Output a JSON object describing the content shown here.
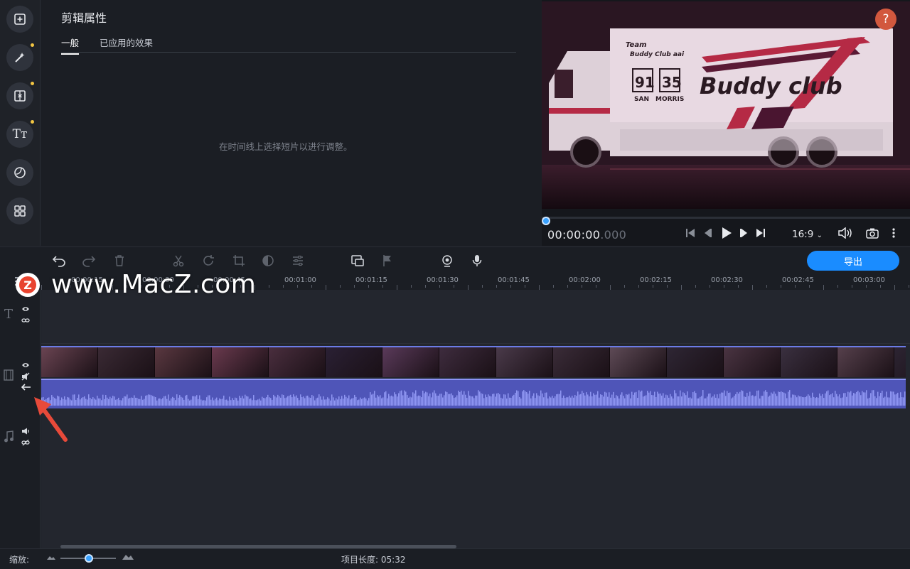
{
  "colors": {
    "accent": "#1a8cff",
    "help": "#d2583e",
    "audio": "#4f55b8",
    "dot": "#f2c542"
  },
  "left_bar": {
    "items": [
      {
        "icon": "import-icon",
        "has_dot": false
      },
      {
        "icon": "magic-wand-icon",
        "has_dot": true
      },
      {
        "icon": "transition-icon",
        "has_dot": true
      },
      {
        "icon": "titles-icon",
        "label": "Tт",
        "has_dot": true
      },
      {
        "icon": "stickers-icon",
        "has_dot": false
      },
      {
        "icon": "more-tools-icon",
        "has_dot": false
      }
    ]
  },
  "properties": {
    "title": "剪辑属性",
    "tabs": [
      {
        "label": "一般",
        "active": true
      },
      {
        "label": "已应用的效果",
        "active": false
      }
    ],
    "hint": "在时间线上选择短片以进行调整。"
  },
  "preview": {
    "video": {
      "team_text": "Team\nBuddy Club aai",
      "number_left": "91",
      "number_right": "35",
      "name_left": "SAN",
      "name_right": "MORRIS",
      "brand": "Buddy club"
    },
    "help_label": "?",
    "timecode_main": "00:00:00",
    "timecode_ms": ".000",
    "aspect_ratio": "16:9"
  },
  "toolbar": {
    "export_label": "导出"
  },
  "ruler": {
    "labels": [
      "00:00:15",
      "00:00:30",
      "00:00:45",
      "00:01:00",
      "00:01:15",
      "00:01:30",
      "00:01:45",
      "00:02:00",
      "00:02:15",
      "00:02:30",
      "00:02:45",
      "00:03:00"
    ]
  },
  "bottom": {
    "zoom_label": "缩放:",
    "zoom_level": 0.45,
    "duration_label": "项目长度:",
    "duration_value": "05:32"
  },
  "watermark": {
    "logo": "Z",
    "text": "www.MacZ.com"
  }
}
